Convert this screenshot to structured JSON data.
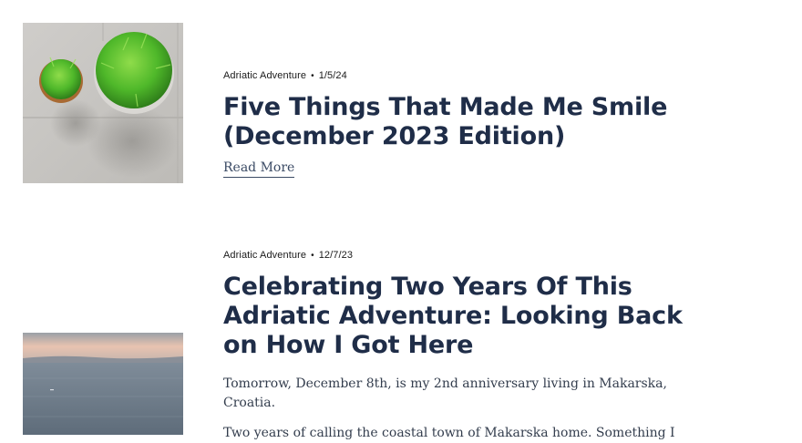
{
  "posts": [
    {
      "category": "Adriatic Adventure",
      "separator": "•",
      "date": "1/5/24",
      "title": "Five Things That Made Me Smile (December 2023 Edition)",
      "read_more": "Read More",
      "image": "potted-grass-plants-photo"
    },
    {
      "category": "Adriatic Adventure",
      "separator": "•",
      "date": "12/7/23",
      "title": "Celebrating Two Years Of This Adriatic Adventure: Looking Back on How I Got Here",
      "excerpt_1": "Tomorrow, December 8th, is my 2nd anniversary living in Makarska, Croatia.",
      "excerpt_2": "Two years of calling the coastal town of Makarska home. Something I",
      "image": "sea-horizon-photo"
    }
  ]
}
